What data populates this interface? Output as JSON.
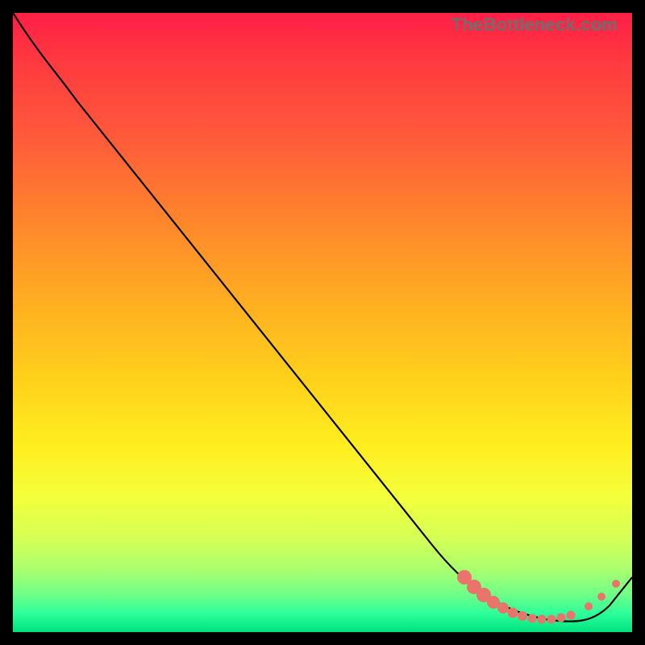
{
  "watermark": "TheBottleneck.com",
  "colors": {
    "marker": "#e8746c",
    "curve": "#000000"
  },
  "chart_data": {
    "type": "line",
    "title": "",
    "xlabel": "",
    "ylabel": "",
    "xlim": [
      0,
      100
    ],
    "ylim": [
      0,
      100
    ],
    "grid": false,
    "series": [
      {
        "name": "bottleneck-curve",
        "x": [
          0,
          6,
          12,
          20,
          30,
          40,
          50,
          60,
          68,
          72,
          76,
          80,
          84,
          88,
          92,
          96,
          100
        ],
        "y": [
          100,
          93,
          86,
          77,
          65,
          53,
          41,
          29,
          19,
          13,
          8,
          4,
          2,
          1,
          2,
          6,
          12
        ]
      }
    ],
    "markers": {
      "name": "highlighted-points",
      "color": "#e8746c",
      "x": [
        74,
        76,
        78,
        80,
        82,
        84,
        86,
        88,
        90,
        92,
        94
      ],
      "y": [
        11,
        8,
        6,
        4,
        3,
        2,
        1.5,
        1,
        1.5,
        2,
        4
      ]
    }
  }
}
